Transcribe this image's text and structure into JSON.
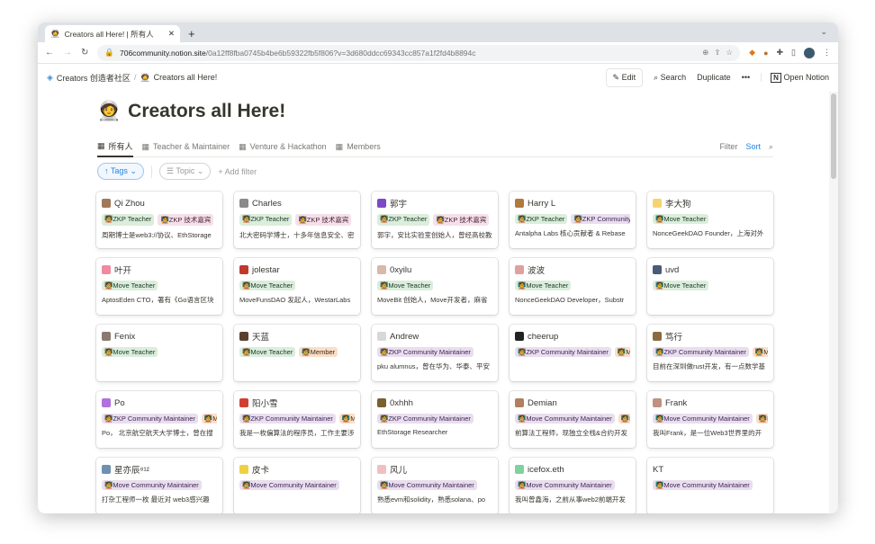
{
  "browser": {
    "tab_title": "Creators all Here!  | 所有人",
    "url_domain": "706community.notion.site",
    "url_path": "/0a12ff8fba0745b4be6b59322fb5f806?v=3d680ddcc69343cc857a1f2fd4b8894c"
  },
  "topbar": {
    "breadcrumb_root": "Creators 创造者社区",
    "breadcrumb_sep": "/",
    "breadcrumb_page": "Creators all Here!",
    "edit": "Edit",
    "search": "Search",
    "duplicate": "Duplicate",
    "more": "•••",
    "open_notion": "Open Notion"
  },
  "page": {
    "emoji": "🧑‍🚀",
    "title": "Creators all Here!"
  },
  "views": {
    "tabs": [
      "所有人",
      "Teacher & Maintainer",
      "Venture & Hackathon",
      "Members"
    ],
    "filter": "Filter",
    "sort": "Sort"
  },
  "filters": {
    "tags": "Tags",
    "topic": "Topic",
    "add": "Add filter"
  },
  "cards": [
    {
      "name": "Qi Zhou",
      "icon": "#a0785a",
      "tags": [
        {
          "t": "ZKP Teacher",
          "c": "g"
        },
        {
          "t": "ZKP 技术嘉宾",
          "c": "p"
        }
      ],
      "desc": "周期博士是web3://协议、EthStorage"
    },
    {
      "name": "Charles",
      "icon": "#8a8a8a",
      "tags": [
        {
          "t": "ZKP Teacher",
          "c": "g"
        },
        {
          "t": "ZKP 技术嘉宾",
          "c": "p"
        }
      ],
      "desc": "北大密码学博士，十多年信息安全、密"
    },
    {
      "name": "郭宇",
      "icon": "#7d4bc4",
      "tags": [
        {
          "t": "ZKP Teacher",
          "c": "g"
        },
        {
          "t": "ZKP 技术嘉宾",
          "c": "p"
        }
      ],
      "desc": "郭宇，安比实验室创始人，曾经高校教"
    },
    {
      "name": "Harry L",
      "icon": "#b07a3c",
      "tags": [
        {
          "t": "ZKP Teacher",
          "c": "g"
        },
        {
          "t": "ZKP Community Maintainer",
          "c": "u"
        }
      ],
      "desc": "Antalpha Labs 核心贡献者 & Rebase"
    },
    {
      "name": "李大狗",
      "icon": "#f5d572",
      "tags": [
        {
          "t": "Move Teacher",
          "c": "g"
        }
      ],
      "desc": "NonceGeekDAO Founder，上海对外"
    },
    {
      "name": "叶开",
      "icon": "#f08aa0",
      "tags": [
        {
          "t": "Move Teacher",
          "c": "g"
        }
      ],
      "desc": "AptosEden CTO，著有《Go语言区块"
    },
    {
      "name": "jolestar",
      "icon": "#c0392b",
      "tags": [
        {
          "t": "Move Teacher",
          "c": "g"
        }
      ],
      "desc": "MoveFunsDAO 发起人，WestarLabs"
    },
    {
      "name": "0xyilu",
      "icon": "#d8b8a8",
      "tags": [
        {
          "t": "Move Teacher",
          "c": "g"
        }
      ],
      "desc": "MoveBit 创始人，Move开发者，麻省"
    },
    {
      "name": "波波",
      "icon": "#e0a0a0",
      "tags": [
        {
          "t": "Move Teacher",
          "c": "g"
        }
      ],
      "desc": "NonceGeekDAO Developer，Substr"
    },
    {
      "name": "uvd",
      "icon": "#4a5a78",
      "tags": [
        {
          "t": "Move Teacher",
          "c": "g"
        }
      ],
      "desc": ""
    },
    {
      "name": "Fenix",
      "icon": "#8a7a70",
      "tags": [
        {
          "t": "Move Teacher",
          "c": "g"
        }
      ],
      "desc": ""
    },
    {
      "name": "天蓝",
      "icon": "#5a4030",
      "tags": [
        {
          "t": "Move Teacher",
          "c": "g"
        },
        {
          "t": "Member",
          "c": "o"
        }
      ],
      "desc": ""
    },
    {
      "name": "Andrew",
      "icon": "#d8d8d8",
      "tags": [
        {
          "t": "ZKP Community Maintainer",
          "c": "u"
        }
      ],
      "desc": "pku alumnus，曾在华为、华泰、平安"
    },
    {
      "name": "cheerup",
      "icon": "#222222",
      "tags": [
        {
          "t": "ZKP Community Maintainer",
          "c": "u"
        },
        {
          "t": "Member",
          "c": "o"
        }
      ],
      "desc": ""
    },
    {
      "name": "笃行",
      "icon": "#8a6a40",
      "tags": [
        {
          "t": "ZKP Community Maintainer",
          "c": "u"
        },
        {
          "t": "Member",
          "c": "o"
        }
      ],
      "desc": "目前在深圳做rust开发，有一点数学基"
    },
    {
      "name": "Po",
      "icon": "#b070e0",
      "tags": [
        {
          "t": "ZKP Community Maintainer",
          "c": "u"
        },
        {
          "t": "Member",
          "c": "o"
        }
      ],
      "desc": "Po， 北京航空航天大学博士，曾在搜"
    },
    {
      "name": "阳小雪",
      "icon": "#d04030",
      "tags": [
        {
          "t": "ZKP Community Maintainer",
          "c": "u"
        },
        {
          "t": "Member",
          "c": "o"
        }
      ],
      "desc": "我是一枚偏算法的程序员，工作主要涉"
    },
    {
      "name": "0xhhh",
      "icon": "#7a6030",
      "tags": [
        {
          "t": "ZKP Community Maintainer",
          "c": "u"
        }
      ],
      "desc": "EthStorage Researcher"
    },
    {
      "name": "Demian",
      "icon": "#b08060",
      "tags": [
        {
          "t": "Move Community Maintainer",
          "c": "u"
        },
        {
          "t": "Member",
          "c": "o"
        }
      ],
      "desc": "前算法工程师，现独立全栈&合约开发"
    },
    {
      "name": "Frank",
      "icon": "#c09080",
      "tags": [
        {
          "t": "Move Community Maintainer",
          "c": "u"
        },
        {
          "t": "Member",
          "c": "o"
        }
      ],
      "desc": "我叫Frank，是一位Web3世界里的开"
    },
    {
      "name": "星亦辰⁸¹²",
      "icon": "#7090b0",
      "tags": [
        {
          "t": "Move Community Maintainer",
          "c": "u"
        }
      ],
      "desc": "打杂工程师一枚 最近对 web3感兴趣"
    },
    {
      "name": "皮卡",
      "icon": "#f0d040",
      "tags": [
        {
          "t": "Move Community Maintainer",
          "c": "u"
        }
      ],
      "desc": ""
    },
    {
      "name": "风儿",
      "icon": "#f0c0c0",
      "tags": [
        {
          "t": "Move Community Maintainer",
          "c": "u"
        }
      ],
      "desc": "熟悉evm和solidity，熟悉solana、po"
    },
    {
      "name": "icefox.eth",
      "icon": "#80d0a0",
      "tags": [
        {
          "t": "Move Community Maintainer",
          "c": "u"
        }
      ],
      "desc": "我叫曾鑫海，之前从事web2前端开发"
    },
    {
      "name": "KT",
      "icon": "",
      "tags": [
        {
          "t": "Move Community Maintainer",
          "c": "u"
        }
      ],
      "desc": ""
    }
  ]
}
